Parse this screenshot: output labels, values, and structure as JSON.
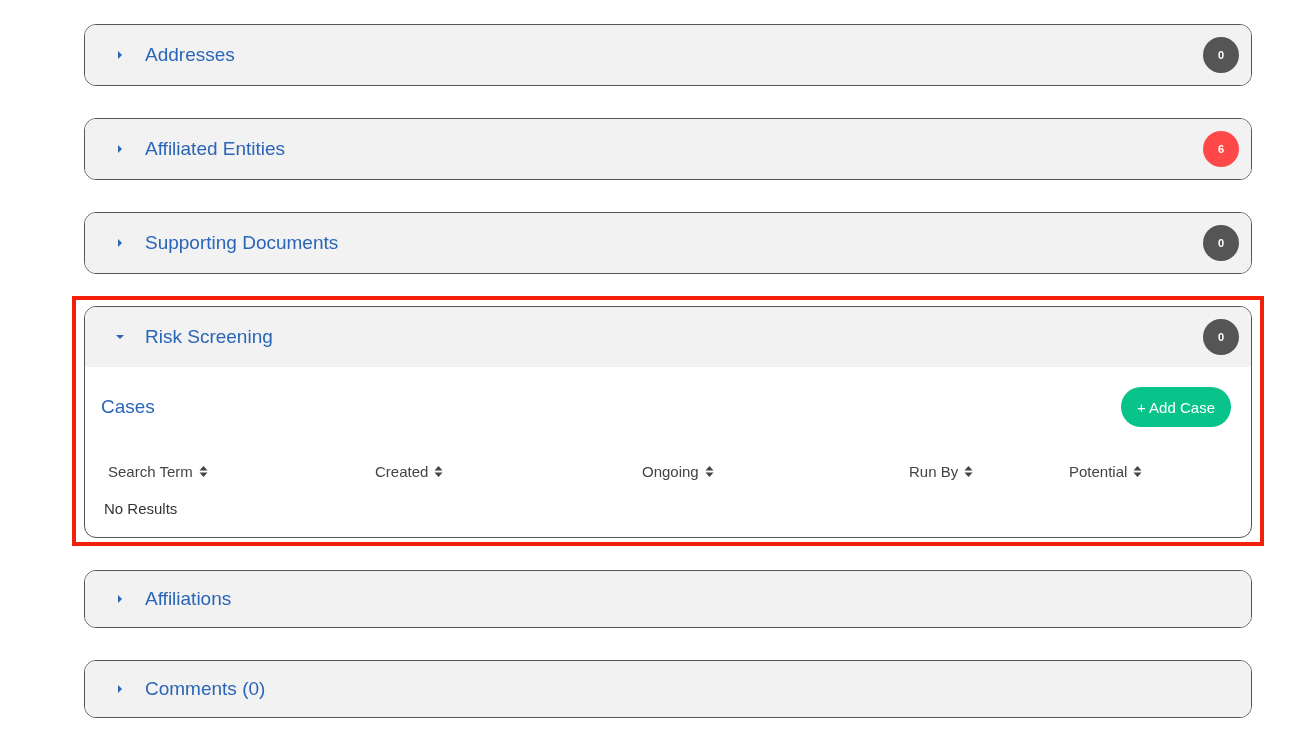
{
  "sections": [
    {
      "title": "Addresses",
      "expanded": false,
      "highlighted": false,
      "badge": {
        "count": "0",
        "color": "#555555"
      }
    },
    {
      "title": "Affiliated Entities",
      "expanded": false,
      "highlighted": false,
      "badge": {
        "count": "6",
        "color": "#ff4949"
      }
    },
    {
      "title": "Supporting Documents",
      "expanded": false,
      "highlighted": false,
      "badge": {
        "count": "0",
        "color": "#555555"
      }
    },
    {
      "title": "Risk Screening",
      "expanded": true,
      "highlighted": true,
      "badge": {
        "count": "0",
        "color": "#555555"
      },
      "content": {
        "heading": "Cases",
        "button": "+ Add Case",
        "columns": [
          "Search Term",
          "Created",
          "Ongoing",
          "Run By",
          "Potential"
        ],
        "empty_text": "No Results"
      }
    },
    {
      "title": "Affiliations",
      "expanded": false,
      "highlighted": false
    },
    {
      "title": "Comments (0)",
      "expanded": false,
      "highlighted": false
    }
  ]
}
